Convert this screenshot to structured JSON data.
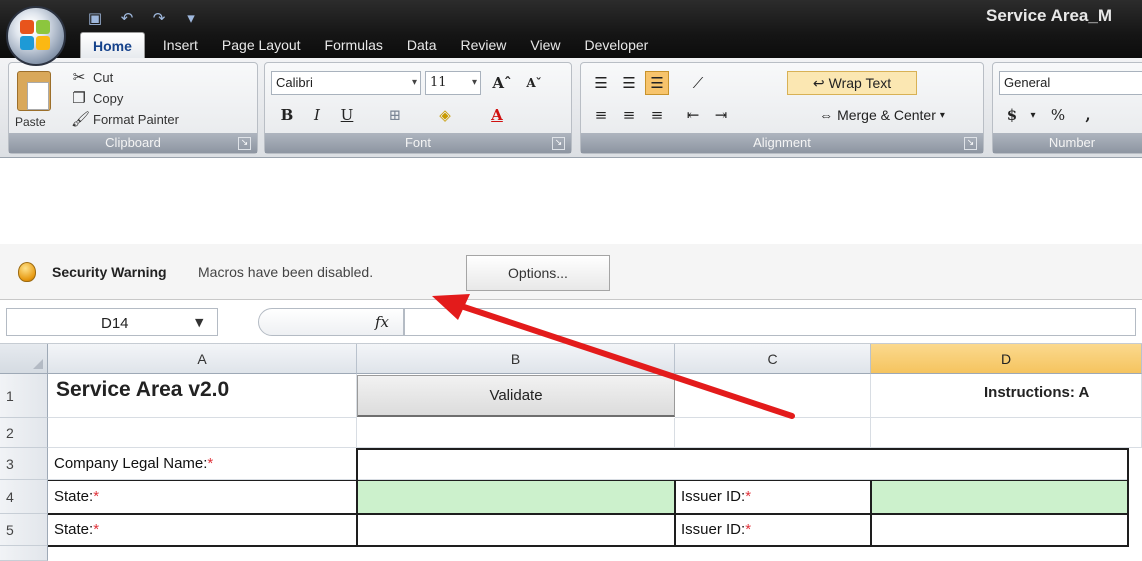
{
  "window": {
    "title": "Service Area_M"
  },
  "quick_access": [
    {
      "icon": "save-icon",
      "glyph": "▣"
    },
    {
      "icon": "undo-icon",
      "glyph": "↶"
    },
    {
      "icon": "redo-icon",
      "glyph": "↷"
    },
    {
      "icon": "customize-icon",
      "glyph": "▾"
    }
  ],
  "tabs": [
    "Home",
    "Insert",
    "Page Layout",
    "Formulas",
    "Data",
    "Review",
    "View",
    "Developer"
  ],
  "ribbon": {
    "clipboard": {
      "label": "Clipboard",
      "paste": "Paste",
      "cut": "Cut",
      "copy": "Copy",
      "format_painter": "Format Painter"
    },
    "font": {
      "label": "Font",
      "family": "Calibri",
      "size": "11",
      "grow": "Aˆ",
      "shrink": "Aˇ",
      "bold": "B",
      "italic": "I",
      "underline": "U"
    },
    "alignment": {
      "label": "Alignment",
      "wrap_text": "Wrap Text",
      "merge_center": "Merge & Center"
    },
    "number": {
      "label": "Number",
      "format": "General",
      "currency": "$",
      "percent": "%",
      "comma": ","
    }
  },
  "security": {
    "title": "Security Warning",
    "message": "Macros have been disabled.",
    "options_button": "Options..."
  },
  "formula_bar": {
    "name_box": "D14",
    "fx": "fx",
    "value": ""
  },
  "sheet": {
    "columns": [
      "A",
      "B",
      "C",
      "D"
    ],
    "selected_column": "D",
    "rows": [
      "1",
      "2",
      "3",
      "4",
      "5"
    ],
    "title": "Service Area v2.0",
    "validate_button": "Validate",
    "instructions": "Instructions: A",
    "company_label": "Company Legal Name:",
    "state_label": "State:",
    "issuer_label": "Issuer ID:",
    "required_marker": "*"
  },
  "colors": {
    "accent_arrow": "#e31b1b",
    "input_fill": "#ccf1cc",
    "selected_header": "#f5c45f"
  }
}
